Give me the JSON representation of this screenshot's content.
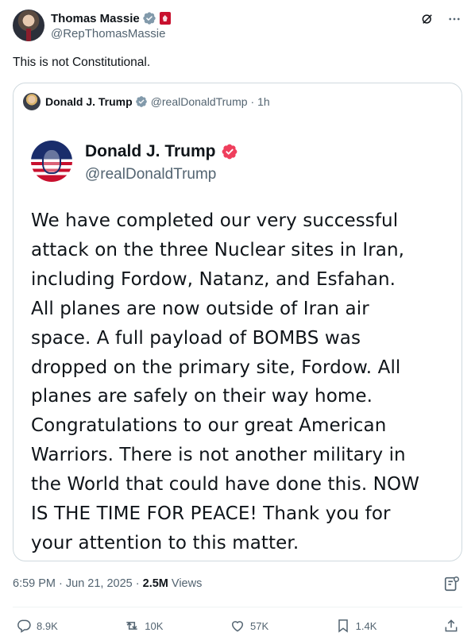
{
  "author": {
    "display_name": "Thomas Massie",
    "handle": "@RepThomasMassie",
    "verified": true
  },
  "tweet": {
    "text": "This is not Constitutional."
  },
  "quoted": {
    "display_name": "Donald J. Trump",
    "handle": "@realDonaldTrump",
    "time": "· 1h",
    "card": {
      "display_name": "Donald J. Trump",
      "handle": "@realDonaldTrump",
      "lines": [
        "We have completed our very successful",
        "attack on the three Nuclear sites in Iran,",
        "including Fordow, Natanz, and Esfahan.",
        "All planes are now outside of Iran air",
        "space. A full payload of BOMBS was",
        "dropped on the primary site, Fordow. All",
        "planes are safely on their way home.",
        "Congratulations to our great American",
        "Warriors. There is not another military in",
        "the World that could have done this. NOW",
        "IS THE TIME FOR PEACE! Thank you for",
        "your attention to this matter."
      ]
    }
  },
  "meta": {
    "timestamp": "6:59 PM · Jun 21, 2025 · ",
    "views_count": "2.5M",
    "views_label": " Views"
  },
  "actions": {
    "replies": "8.9K",
    "reposts": "10K",
    "likes": "57K",
    "bookmarks": "1.4K"
  },
  "colors": {
    "verified_blue": "#1d9bf0",
    "truthsocial_check": "#ef3e5c",
    "muted_text": "#536471"
  },
  "icons": [
    "verified-icon",
    "party-badge-icon",
    "grok-icon",
    "more-icon",
    "analytics-icon",
    "reply-icon",
    "repost-icon",
    "like-icon",
    "bookmark-icon",
    "share-icon"
  ]
}
